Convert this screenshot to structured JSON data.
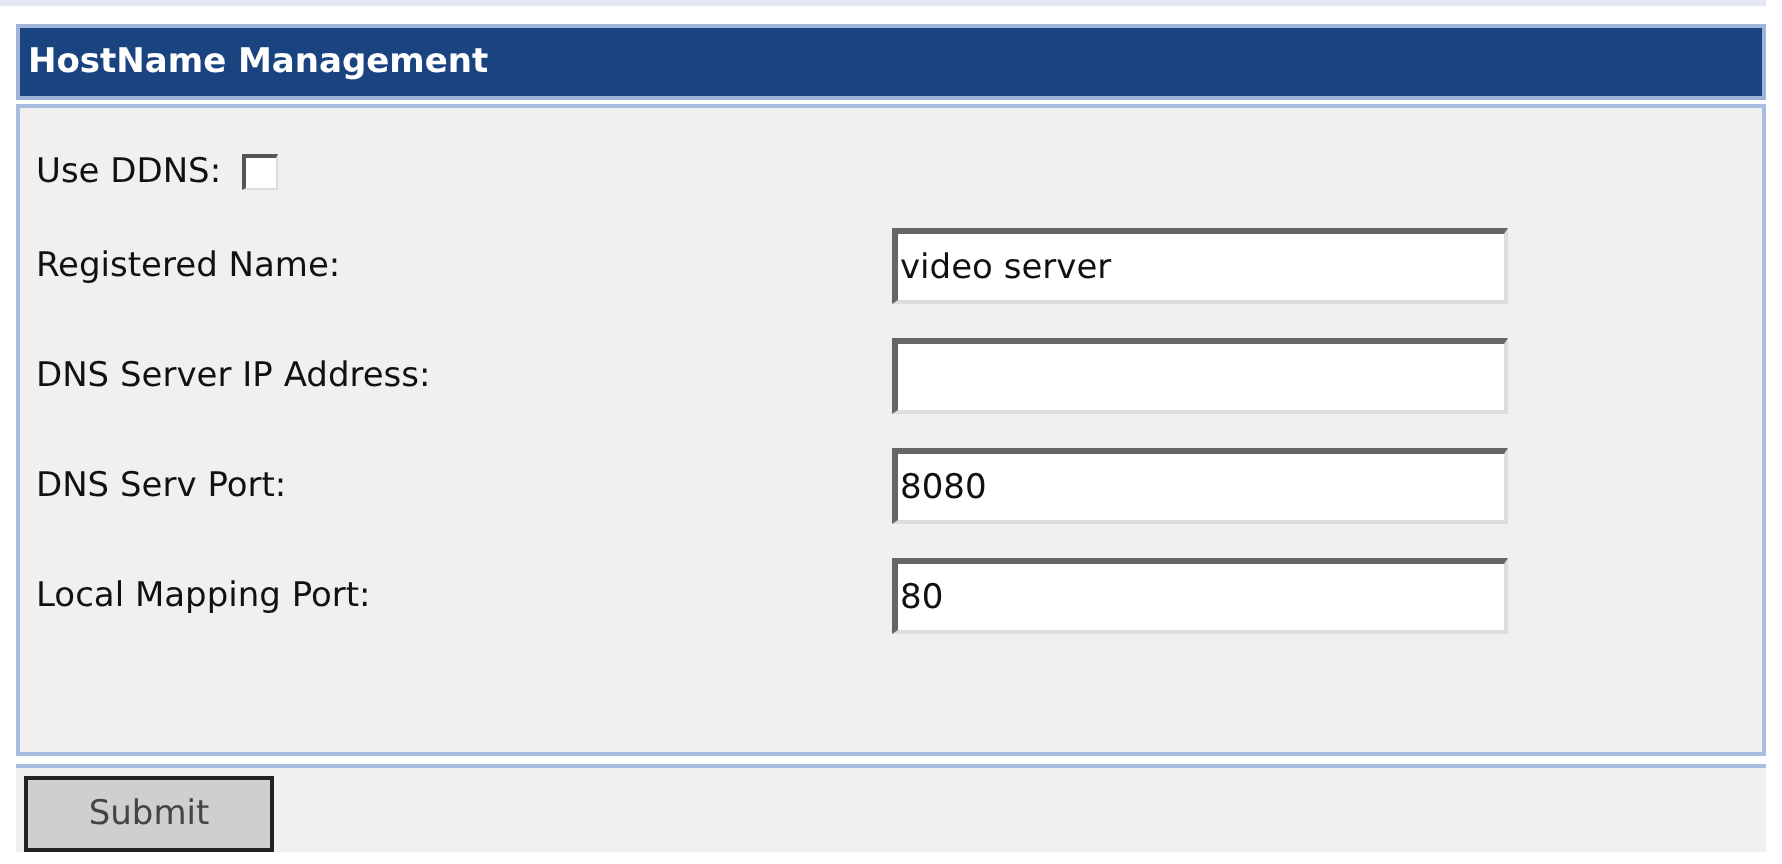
{
  "header": {
    "title": "HostName Management"
  },
  "ddns": {
    "label": "Use DDNS:",
    "checked": false
  },
  "fields": [
    {
      "label": "Registered Name:",
      "value": "video server"
    },
    {
      "label": "DNS Server IP Address:"
    },
    {
      "label": "DNS Serv Port:",
      "value": "8080"
    },
    {
      "label": "Local Mapping Port:",
      "value": "80"
    }
  ],
  "submit": {
    "label": "Submit"
  }
}
